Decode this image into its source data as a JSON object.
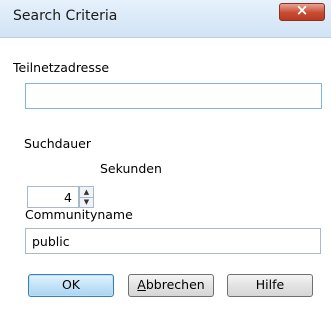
{
  "window": {
    "title": "Search Criteria",
    "close_icon": "×"
  },
  "fields": {
    "subnet_label": "Teilnetzadresse",
    "subnet_value": "",
    "duration_label": "Suchdauer",
    "duration_value": "4",
    "duration_unit": "Sekunden",
    "community_label": "Communityname",
    "community_value": "public"
  },
  "spinner": {
    "up_glyph": "▲",
    "down_glyph": "▼"
  },
  "buttons": {
    "ok_label": "OK",
    "cancel_mnemonic": "A",
    "cancel_rest": "bbrechen",
    "help_label": "Hilfe"
  },
  "icons": {
    "close": "close-icon",
    "spin_up": "spin-up-icon",
    "spin_down": "spin-down-icon"
  }
}
